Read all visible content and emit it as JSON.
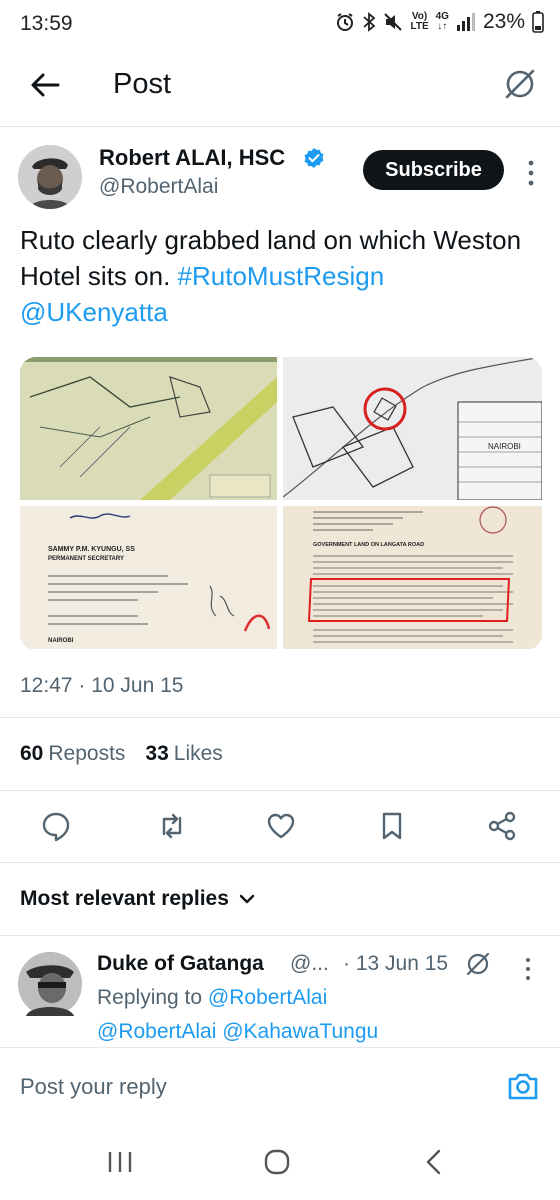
{
  "status_bar": {
    "time": "13:59",
    "network_top": "Vo)",
    "network_bottom": "LTE",
    "data_top": "4G",
    "data_bottom": "↓↑",
    "battery": "23%"
  },
  "header": {
    "title": "Post"
  },
  "post": {
    "author_name": "Robert ALAI, HSC",
    "author_handle": "@RobertAlai",
    "subscribe_label": "Subscribe",
    "text_plain": "Ruto clearly grabbed land on which Weston Hotel sits on.",
    "hashtag": "#RutoMustResign",
    "mention": "@UKenyatta",
    "timestamp": "12:47 · 10 Jun 15",
    "reposts_count": "60",
    "reposts_label": "Reposts",
    "likes_count": "33",
    "likes_label": "Likes",
    "media": {
      "tile_2_caption": "NAIROBI",
      "tile_3_name": "SAMMY P.M. KYUNGU, SS",
      "tile_3_title": "PERMANENT SECRETARY",
      "tile_3_city": "NAIROBI",
      "tile_4_heading": "GOVERNMENT LAND ON LANGATA ROAD"
    }
  },
  "replies_section": {
    "label": "Most relevant replies"
  },
  "reply": {
    "author_name": "Duke of Gatanga",
    "author_handle": "@...",
    "date": "· 13 Jun 15",
    "replying_prefix": "Replying to",
    "replying_to": "@RobertAlai",
    "text": "@RobertAlai @KahawaTungu"
  },
  "composer": {
    "placeholder": "Post your reply"
  },
  "icons": {
    "back": "arrow-left-icon",
    "grok": "grok-icon",
    "verified": "verified-badge-icon",
    "more": "more-vertical-icon",
    "reply": "reply-icon",
    "repost": "repost-icon",
    "like": "heart-icon",
    "bookmark": "bookmark-icon",
    "share": "share-icon",
    "camera": "camera-icon",
    "chevron": "chevron-down-icon"
  },
  "colors": {
    "link": "#1d9bf0",
    "text": "#0f1419",
    "secondary": "#536471",
    "button_bg": "#0f1419"
  }
}
